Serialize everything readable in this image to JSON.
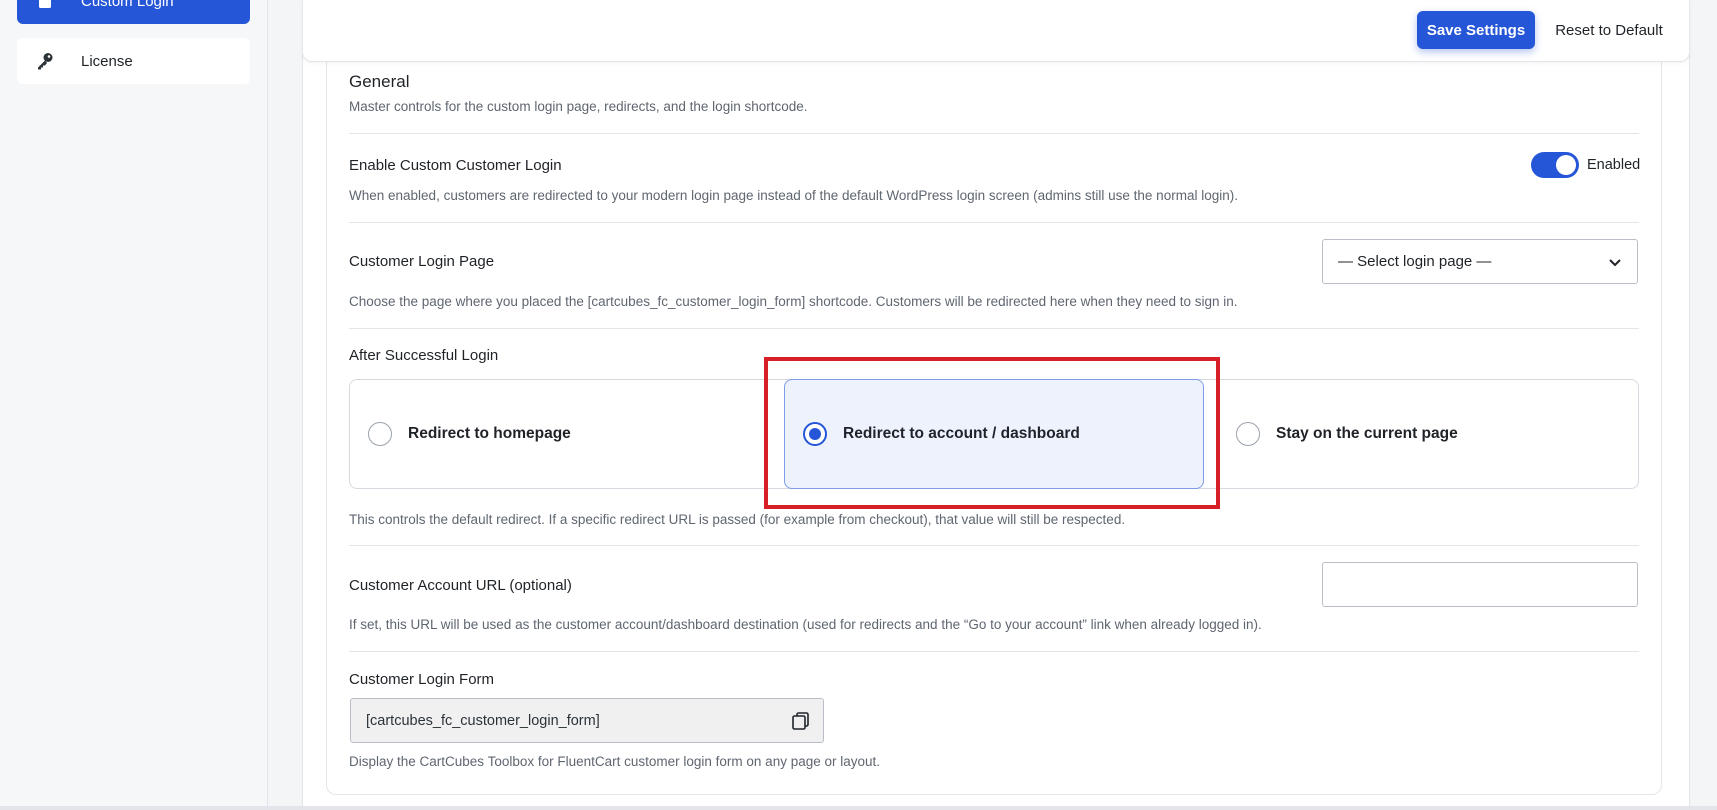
{
  "sidebar": {
    "active_item": {
      "label": "Custom Login",
      "icon": "lock-icon"
    },
    "license_item": {
      "label": "License",
      "icon": "key-icon"
    }
  },
  "toolbar": {
    "save_label": "Save Settings",
    "reset_label": "Reset to Default"
  },
  "section": {
    "title": "General",
    "description": "Master controls for the custom login page, redirects, and the login shortcode."
  },
  "enable_login": {
    "label": "Enable Custom Customer Login",
    "description": "When enabled, customers are redirected to your modern login page instead of the default WordPress login screen (admins still use the normal login).",
    "toggle_state": "Enabled",
    "checked": true
  },
  "login_page": {
    "label": "Customer Login Page",
    "selected": "— Select login page —",
    "description": "Choose the page where you placed the [cartcubes_fc_customer_login_form] shortcode. Customers will be redirected here when they need to sign in."
  },
  "after_login": {
    "label": "After Successful Login",
    "options": [
      {
        "label": "Redirect to homepage",
        "selected": false
      },
      {
        "label": "Redirect to account / dashboard",
        "selected": true
      },
      {
        "label": "Stay on the current page",
        "selected": false
      }
    ],
    "description": "This controls the default redirect. If a specific redirect URL is passed (for example from checkout), that value will still be respected."
  },
  "account_url": {
    "label": "Customer Account URL (optional)",
    "value": "",
    "description": "If set, this URL will be used as the customer account/dashboard destination (used for redirects and the “Go to your account” link when already logged in)."
  },
  "login_form": {
    "label": "Customer Login Form",
    "shortcode": "[cartcubes_fc_customer_login_form]",
    "description": "Display the CartCubes Toolbox for FluentCart customer login form on any page or layout."
  },
  "colors": {
    "accent": "#2556d8",
    "highlight_box": "#d61f26",
    "selected_bg": "#eef2fd"
  }
}
